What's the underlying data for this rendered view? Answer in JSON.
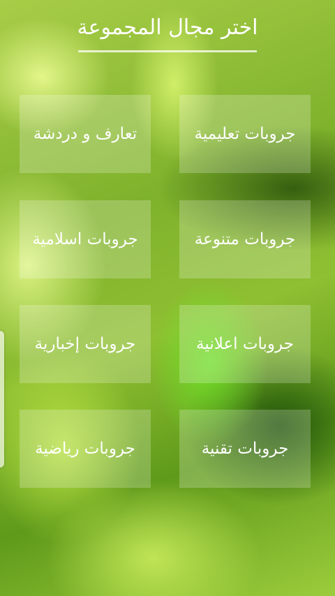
{
  "header": {
    "title": "اختر مجال المجموعة"
  },
  "groups": [
    {
      "label": "جروبات تعليمية"
    },
    {
      "label": "تعارف و دردشة"
    },
    {
      "label": "جروبات متنوعة"
    },
    {
      "label": "جروبات اسلامية"
    },
    {
      "label": "جروبات اعلانية"
    },
    {
      "label": "جروبات إخبارية"
    },
    {
      "label": "جروبات تقنية"
    },
    {
      "label": "جروبات رياضية"
    }
  ]
}
